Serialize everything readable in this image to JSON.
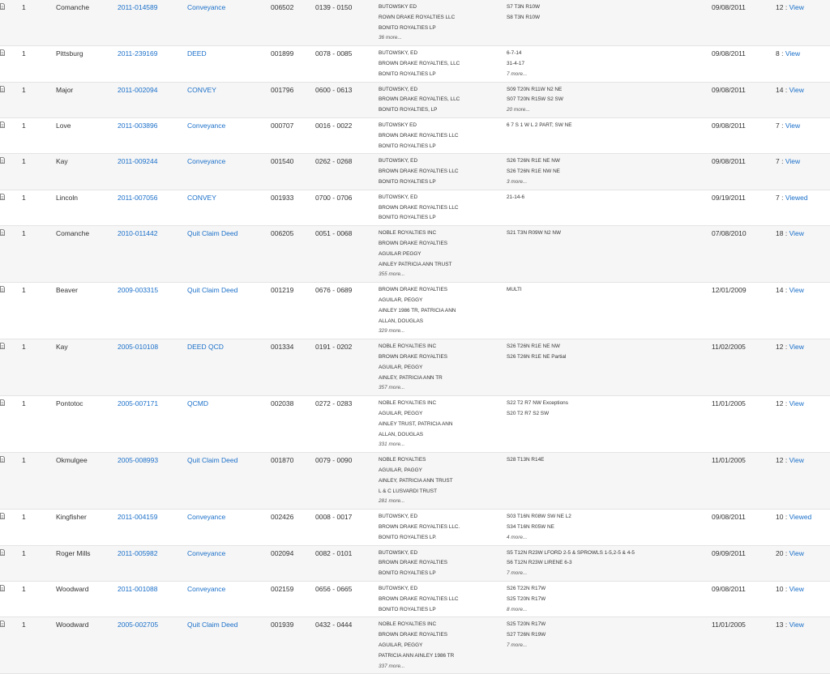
{
  "colors": {
    "link": "#1a6fc9",
    "row_alt": "#f6f6f6",
    "border": "#e4e4e4"
  },
  "icons": {
    "document": "document-icon"
  },
  "rows": [
    {
      "seq": "1",
      "county": "Comanche",
      "instrument": "2011-014589",
      "doc_type": "Conveyance",
      "book": "006502",
      "pages": "0139 - 0150",
      "names": [
        "BUTOWSKY ED",
        "ROWN DRAKE ROYALTIES LLC",
        "BONITO ROYALTIES LP"
      ],
      "names_more": "36 more...",
      "legal": [
        "S7 T3N R10W",
        "S8 T3N R10W"
      ],
      "legal_more": "",
      "date": "09/08/2011",
      "page_count": "12",
      "view": "View",
      "viewed": false
    },
    {
      "seq": "1",
      "county": "Pittsburg",
      "instrument": "2011-239169",
      "doc_type": "DEED",
      "book": "001899",
      "pages": "0078 - 0085",
      "names": [
        "BUTOWSKY, ED",
        "BROWN DRAKE ROYALTIES, LLC",
        "BONITO ROYALTIES LP"
      ],
      "names_more": "",
      "legal": [
        "6-7-14",
        "31-4-17"
      ],
      "legal_more": "7 more...",
      "date": "09/08/2011",
      "page_count": "8",
      "view": "View",
      "viewed": false
    },
    {
      "seq": "1",
      "county": "Major",
      "instrument": "2011-002094",
      "doc_type": "CONVEY",
      "book": "001796",
      "pages": "0600 - 0613",
      "names": [
        "BUTOWSKY, ED",
        "BROWN DRAKE ROYALTIES, LLC",
        "BONITO ROYALTIES, LP"
      ],
      "names_more": "",
      "legal": [
        "S09 T20N R11W N2 NE",
        "S07 T20N R15W S2 SW"
      ],
      "legal_more": "20 more...",
      "date": "09/08/2011",
      "page_count": "14",
      "view": "View",
      "viewed": false
    },
    {
      "seq": "1",
      "county": "Love",
      "instrument": "2011-003896",
      "doc_type": "Conveyance",
      "book": "000707",
      "pages": "0016 - 0022",
      "names": [
        "BUTOWSKY ED",
        "BROWN DRAKE ROYALTIES LLC",
        "BONITO ROYALTIES LP"
      ],
      "names_more": "",
      "legal": [
        "6 7 S 1 W L 2 PART; SW NE"
      ],
      "legal_more": "",
      "date": "09/08/2011",
      "page_count": "7",
      "view": "View",
      "viewed": false
    },
    {
      "seq": "1",
      "county": "Kay",
      "instrument": "2011-009244",
      "doc_type": "Conveyance",
      "book": "001540",
      "pages": "0262 - 0268",
      "names": [
        "BUTOWSKY, ED",
        "BROWN DRAKE ROYALTIES LLC",
        "BONITO ROYALTIES LP"
      ],
      "names_more": "",
      "legal": [
        "S26 T26N R1E NE NW",
        "S26 T26N R1E NW NE"
      ],
      "legal_more": "3 more...",
      "date": "09/08/2011",
      "page_count": "7",
      "view": "View",
      "viewed": false
    },
    {
      "seq": "1",
      "county": "Lincoln",
      "instrument": "2011-007056",
      "doc_type": "CONVEY",
      "book": "001933",
      "pages": "0700 - 0706",
      "names": [
        "BUTOWSKY, ED",
        "BROWN DRAKE ROYALTIES LLC",
        "BONITO ROYALTIES LP"
      ],
      "names_more": "",
      "legal": [
        "21-14-6"
      ],
      "legal_more": "",
      "date": "09/19/2011",
      "page_count": "7",
      "view": "Viewed",
      "viewed": true
    },
    {
      "seq": "1",
      "county": "Comanche",
      "instrument": "2010-011442",
      "doc_type": "Quit Claim Deed",
      "book": "006205",
      "pages": "0051 - 0068",
      "names": [
        "NOBLE ROYALTIES INC",
        "BROWN DRAKE ROYALTIES",
        "AGUILAR PEGGY",
        "AINLEY PATRICIA ANN TRUST"
      ],
      "names_more": "355 more...",
      "legal": [
        "S21 T3N R09W N2 NW"
      ],
      "legal_more": "",
      "date": "07/08/2010",
      "page_count": "18",
      "view": "View",
      "viewed": false
    },
    {
      "seq": "1",
      "county": "Beaver",
      "instrument": "2009-003315",
      "doc_type": "Quit Claim Deed",
      "book": "001219",
      "pages": "0676 - 0689",
      "names": [
        "BROWN DRAKE ROYALTIES",
        "AGUILAR, PEGGY",
        "AINLEY 1986 TR, PATRICIA ANN",
        "ALLAN, DOUGLAS"
      ],
      "names_more": "329 more...",
      "legal": [
        "MULTI"
      ],
      "legal_more": "",
      "date": "12/01/2009",
      "page_count": "14",
      "view": "View",
      "viewed": false
    },
    {
      "seq": "1",
      "county": "Kay",
      "instrument": "2005-010108",
      "doc_type": "DEED QCD",
      "book": "001334",
      "pages": "0191 - 0202",
      "names": [
        "NOBLE ROYALTIES INC",
        "BROWN DRAKE ROYALTIES",
        "AGUILAR, PEGGY",
        "AINLEY, PATRICIA ANN TR"
      ],
      "names_more": "357 more...",
      "legal": [
        "S26 T26N R1E NE NW",
        "S26 T26N R1E NE Partial"
      ],
      "legal_more": "",
      "date": "11/02/2005",
      "page_count": "12",
      "view": "View",
      "viewed": false
    },
    {
      "seq": "1",
      "county": "Pontotoc",
      "instrument": "2005-007171",
      "doc_type": "QCMD",
      "book": "002038",
      "pages": "0272 - 0283",
      "names": [
        "NOBLE ROYALTIES INC",
        "AGUILAR, PEGGY",
        "AINLEY TRUST, PATRICIA ANN",
        "ALLAN, DOUGLAS"
      ],
      "names_more": "331 more...",
      "legal": [
        "S22 T2 R7 NW Exceptions",
        "S20 T2 R7 S2 SW"
      ],
      "legal_more": "",
      "date": "11/01/2005",
      "page_count": "12",
      "view": "View",
      "viewed": false
    },
    {
      "seq": "1",
      "county": "Okmulgee",
      "instrument": "2005-008993",
      "doc_type": "Quit Claim Deed",
      "book": "001870",
      "pages": "0079 - 0090",
      "names": [
        "NOBLE ROYALTIES",
        "AGUILAR, PAGGY",
        "AINLEY, PATRICIA ANN TRUST",
        "L & C LUSVARDI TRUST"
      ],
      "names_more": "281 more...",
      "legal": [
        "S28 T13N R14E"
      ],
      "legal_more": "",
      "date": "11/01/2005",
      "page_count": "12",
      "view": "View",
      "viewed": false
    },
    {
      "seq": "1",
      "county": "Kingfisher",
      "instrument": "2011-004159",
      "doc_type": "Conveyance",
      "book": "002426",
      "pages": "0008 - 0017",
      "names": [
        "BUTOWSKY, ED",
        "BROWN DRAKE ROYALTIES LLC.",
        "BONITO ROYALTIES LP."
      ],
      "names_more": "",
      "legal": [
        "S03 T16N R08W SW NE L2",
        "S34 T16N R05W NE"
      ],
      "legal_more": "4 more...",
      "date": "09/08/2011",
      "page_count": "10",
      "view": "Viewed",
      "viewed": true
    },
    {
      "seq": "1",
      "county": "Roger Mills",
      "instrument": "2011-005982",
      "doc_type": "Conveyance",
      "book": "002094",
      "pages": "0082 - 0101",
      "names": [
        "BUTOWSKY, ED",
        "BROWN DRAKE ROYALTIES",
        "BONITO ROYALTIES LP"
      ],
      "names_more": "",
      "legal": [
        "S5 T12N R23W LFORD 2-5 & SPROWLS 1-5,2-5 & 4-5",
        "S6 T12N R23W LIRENE 6-3"
      ],
      "legal_more": "7 more...",
      "date": "09/09/2011",
      "page_count": "20",
      "view": "View",
      "viewed": false
    },
    {
      "seq": "1",
      "county": "Woodward",
      "instrument": "2011-001088",
      "doc_type": "Conveyance",
      "book": "002159",
      "pages": "0656 - 0665",
      "names": [
        "BUTOWSKY, ED",
        "BROWN DRAKE ROYALTIES LLC",
        "BONITO ROYALTIES LP"
      ],
      "names_more": "",
      "legal": [
        "S26 T22N R17W",
        "S25 T20N R17W"
      ],
      "legal_more": "8 more...",
      "date": "09/08/2011",
      "page_count": "10",
      "view": "View",
      "viewed": false
    },
    {
      "seq": "1",
      "county": "Woodward",
      "instrument": "2005-002705",
      "doc_type": "Quit Claim Deed",
      "book": "001939",
      "pages": "0432 - 0444",
      "names": [
        "NOBLE ROYALTIES INC",
        "BROWN DRAKE ROYALTIES",
        "AGUILAR, PEGGY",
        "PATRICIA ANN AINLEY 1986 TR"
      ],
      "names_more": "337 more...",
      "legal": [
        "S25 T20N R17W",
        "S27 T26N R19W"
      ],
      "legal_more": "7 more...",
      "date": "11/01/2005",
      "page_count": "13",
      "view": "View",
      "viewed": false
    }
  ]
}
